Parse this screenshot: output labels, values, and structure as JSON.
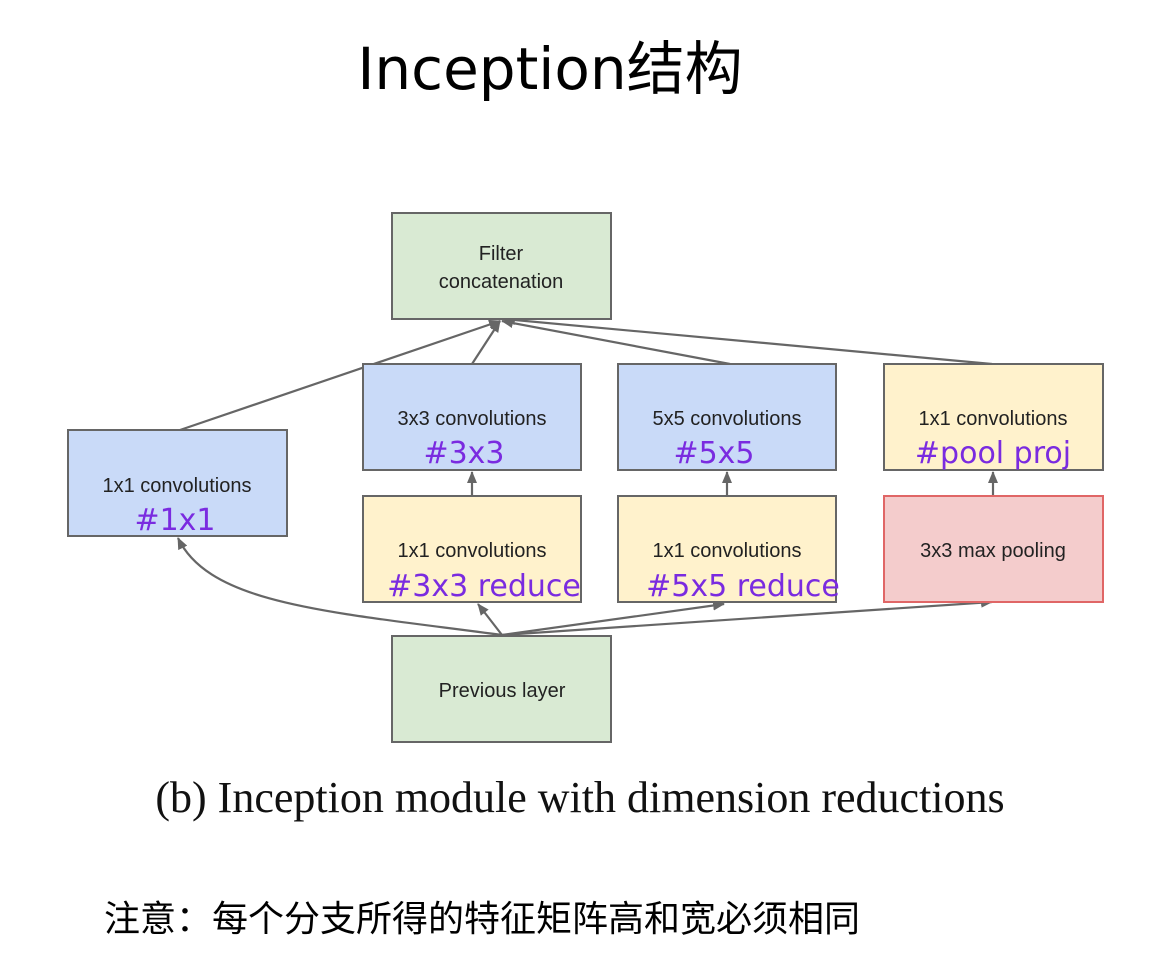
{
  "title": "Inception结构",
  "nodes": {
    "filter_concat": {
      "line1": "Filter",
      "line2": "concatenation",
      "color": "#d9ead3"
    },
    "conv1x1": {
      "label": "1x1 convolutions",
      "annotation": "#1x1",
      "color": "#c9daf8"
    },
    "conv3x3": {
      "label": "3x3 convolutions",
      "annotation": "#3x3",
      "color": "#c9daf8"
    },
    "conv5x5": {
      "label": "5x5 convolutions",
      "annotation": "#5x5",
      "color": "#c9daf8"
    },
    "pool_proj": {
      "label": "1x1 convolutions",
      "annotation": "#pool proj",
      "color": "#fff2cc"
    },
    "reduce3x3": {
      "label": "1x1 convolutions",
      "annotation": "#3x3 reduce",
      "color": "#fff2cc"
    },
    "reduce5x5": {
      "label": "1x1 convolutions",
      "annotation": "#5x5 reduce",
      "color": "#fff2cc"
    },
    "maxpool": {
      "label": "3x3 max pooling",
      "color": "#f4cccc"
    },
    "previous": {
      "label": "Previous layer",
      "color": "#d9ead3"
    }
  },
  "caption": "(b)  Inception module with dimension reductions",
  "note": "注意：每个分支所得的特征矩阵高和宽必须相同",
  "colors": {
    "annotation": "#7a2be0",
    "arrow": "#666666",
    "border": "#666666"
  }
}
